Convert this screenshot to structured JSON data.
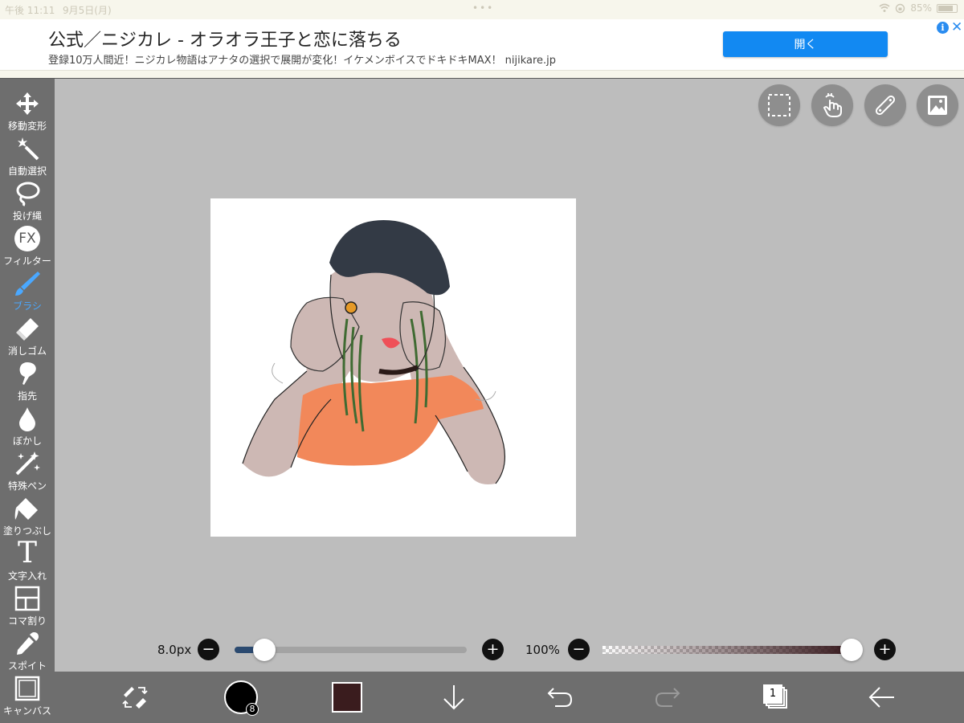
{
  "status_bar": {
    "time": "午後 11:11",
    "date": "9月5日(月)",
    "battery": "85%"
  },
  "ad": {
    "title": "公式／ニジカレ - オラオラ王子と恋に落ちる",
    "description": "登録10万人間近！ニジカレ物語はアナタの選択で展開が変化！イケメンボイスでドキドキMAX！ nijikare.jp",
    "open_button": "開く",
    "info_icon": "i",
    "close_icon": "✕"
  },
  "tools": [
    {
      "label": "移動変形",
      "icon": "move-icon"
    },
    {
      "label": "自動選択",
      "icon": "magic-wand-icon"
    },
    {
      "label": "投げ縄",
      "icon": "lasso-icon"
    },
    {
      "label": "フィルター",
      "icon": "fx-icon",
      "icon_text": "FX"
    },
    {
      "label": "ブラシ",
      "icon": "brush-icon",
      "active": true
    },
    {
      "label": "消しゴム",
      "icon": "eraser-icon"
    },
    {
      "label": "指先",
      "icon": "finger-icon"
    },
    {
      "label": "ぼかし",
      "icon": "blur-drop-icon"
    },
    {
      "label": "特殊ペン",
      "icon": "special-pen-icon"
    },
    {
      "label": "塗りつぶし",
      "icon": "fill-bucket-icon"
    },
    {
      "label": "文字入れ",
      "icon": "text-icon",
      "icon_text": "T"
    },
    {
      "label": "コマ割り",
      "icon": "panel-split-icon"
    },
    {
      "label": "スポイト",
      "icon": "eyedropper-icon"
    },
    {
      "label": "キャンバス",
      "icon": "canvas-icon"
    }
  ],
  "sliders": {
    "brush_size_label": "8.0px",
    "brush_size_fraction": 0.09,
    "opacity_label": "100%",
    "opacity_fraction": 1.0,
    "minus": "−",
    "plus": "+"
  },
  "bottom_bar": {
    "brush_size_badge": "8",
    "current_color": "#3a1c1e",
    "layer_count": "1"
  },
  "colors": {
    "accent_blue": "#1289f2",
    "active_tool": "#4aa8ff",
    "toolbar_bg": "#6e6e6e",
    "workspace_bg": "#bdbdbd"
  }
}
